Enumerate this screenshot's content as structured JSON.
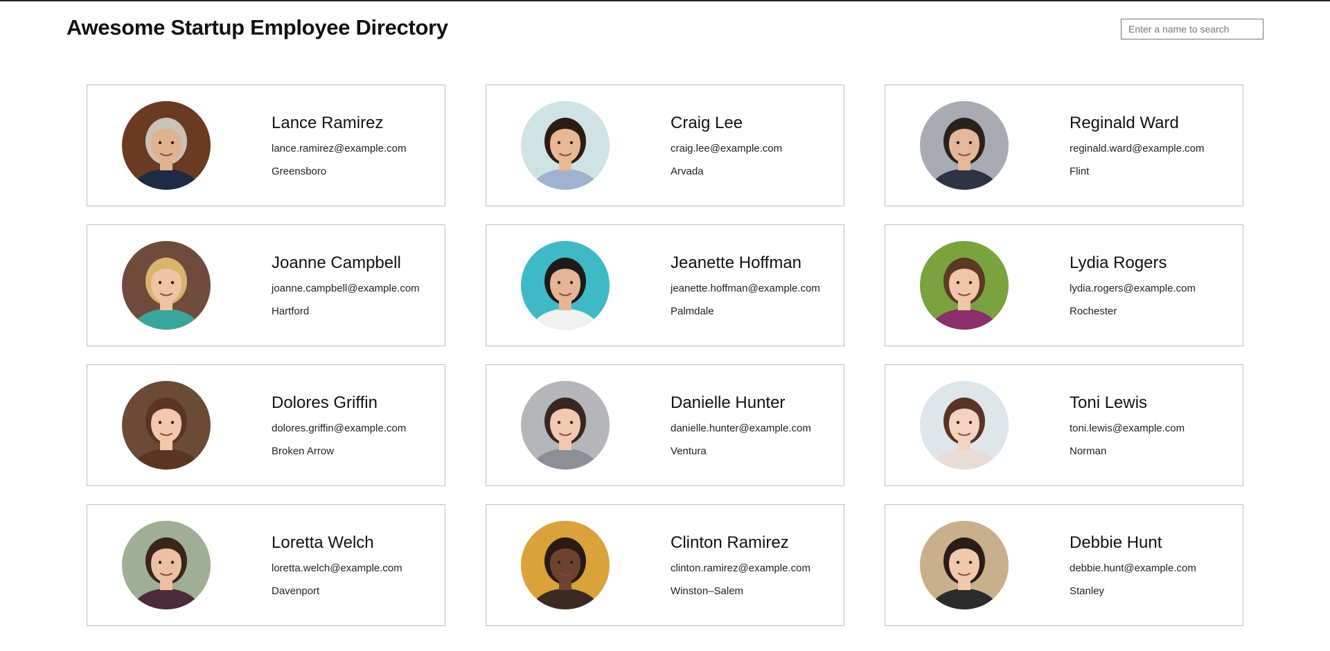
{
  "header": {
    "title": "Awesome Startup Employee Directory",
    "search_placeholder": "Enter a name to search"
  },
  "employees": [
    {
      "name": "Lance Ramirez",
      "email": "lance.ramirez@example.com",
      "city": "Greensboro",
      "avatar": {
        "bg": "#6b3a22",
        "skin": "#e0b28e",
        "hair": "#c9c2b8",
        "shirt": "#1f2a44"
      }
    },
    {
      "name": "Craig Lee",
      "email": "craig.lee@example.com",
      "city": "Arvada",
      "avatar": {
        "bg": "#cfe3e4",
        "skin": "#e8b894",
        "hair": "#2b1d14",
        "shirt": "#9fb3cf"
      }
    },
    {
      "name": "Reginald Ward",
      "email": "reginald.ward@example.com",
      "city": "Flint",
      "avatar": {
        "bg": "#a9abb2",
        "skin": "#e2b79a",
        "hair": "#2a211c",
        "shirt": "#2d3340"
      }
    },
    {
      "name": "Joanne Campbell",
      "email": "joanne.campbell@example.com",
      "city": "Hartford",
      "avatar": {
        "bg": "#6e4b3c",
        "skin": "#efc3a4",
        "hair": "#d9b46a",
        "shirt": "#3aa59a"
      }
    },
    {
      "name": "Jeanette Hoffman",
      "email": "jeanette.hoffman@example.com",
      "city": "Palmdale",
      "avatar": {
        "bg": "#3fb9c6",
        "skin": "#e6b597",
        "hair": "#1e1a1a",
        "shirt": "#f1f1f1"
      }
    },
    {
      "name": "Lydia Rogers",
      "email": "lydia.rogers@example.com",
      "city": "Rochester",
      "avatar": {
        "bg": "#7aa23f",
        "skin": "#f0c6a8",
        "hair": "#5a3a24",
        "shirt": "#8a2f6a"
      }
    },
    {
      "name": "Dolores Griffin",
      "email": "dolores.griffin@example.com",
      "city": "Broken Arrow",
      "avatar": {
        "bg": "#6b4a36",
        "skin": "#f2c7ad",
        "hair": "#5b3524",
        "shirt": "#5b3524"
      }
    },
    {
      "name": "Danielle Hunter",
      "email": "danielle.hunter@example.com",
      "city": "Ventura",
      "avatar": {
        "bg": "#b4b6ba",
        "skin": "#f1c9b2",
        "hair": "#3a2620",
        "shirt": "#8c8f95"
      }
    },
    {
      "name": "Toni Lewis",
      "email": "toni.lewis@example.com",
      "city": "Norman",
      "avatar": {
        "bg": "#dfe6ea",
        "skin": "#f3d3c0",
        "hair": "#5a3328",
        "shirt": "#e7dcd6"
      }
    },
    {
      "name": "Loretta Welch",
      "email": "loretta.welch@example.com",
      "city": "Davenport",
      "avatar": {
        "bg": "#9fae94",
        "skin": "#ecc0a5",
        "hair": "#3a2519",
        "shirt": "#4a2c3a"
      }
    },
    {
      "name": "Clinton Ramirez",
      "email": "clinton.ramirez@example.com",
      "city": "Winston–Salem",
      "avatar": {
        "bg": "#d9a23a",
        "skin": "#6b4330",
        "hair": "#2a1a12",
        "shirt": "#3b2a22"
      }
    },
    {
      "name": "Debbie Hunt",
      "email": "debbie.hunt@example.com",
      "city": "Stanley",
      "avatar": {
        "bg": "#c9b08c",
        "skin": "#f0c8ae",
        "hair": "#2a1c16",
        "shirt": "#2b2b2b"
      }
    }
  ]
}
